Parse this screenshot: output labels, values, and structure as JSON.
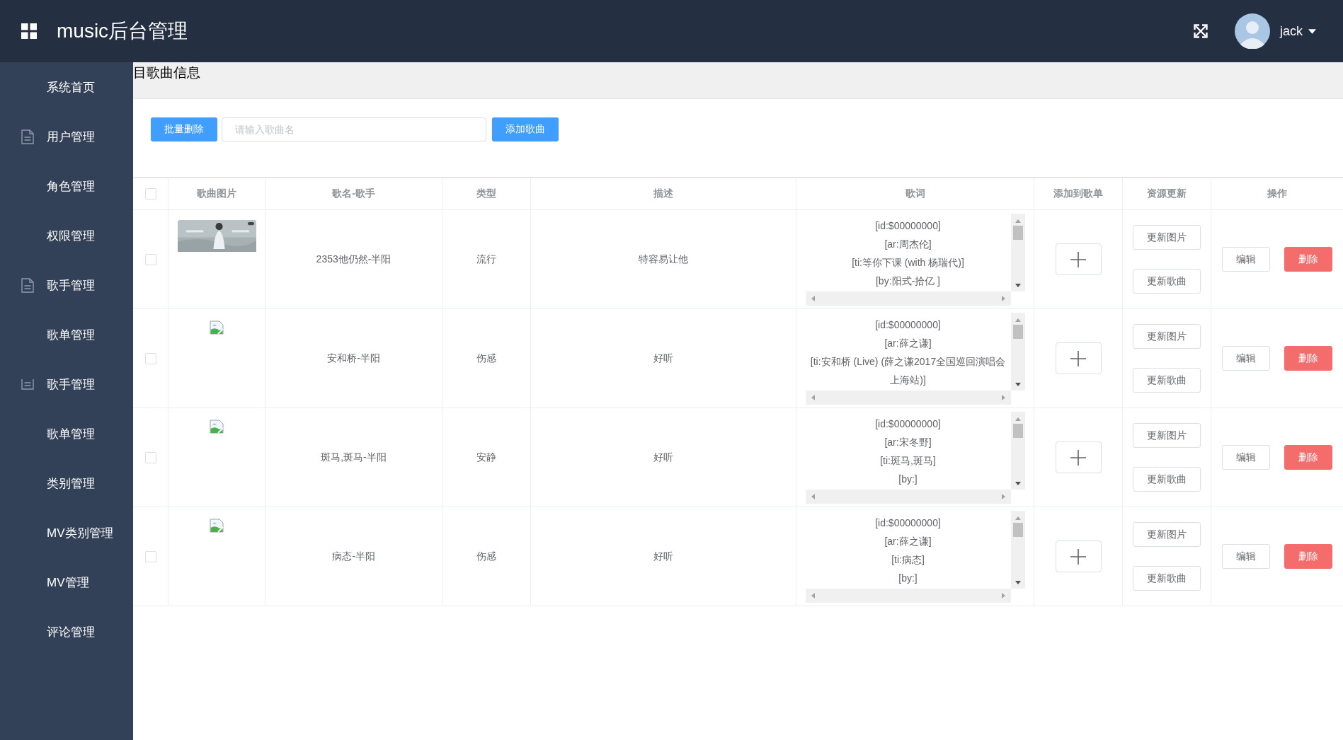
{
  "header": {
    "title": "music后台管理",
    "user": {
      "name": "jack"
    }
  },
  "sidebar": {
    "items": [
      {
        "label": "系统首页",
        "kind": "plain"
      },
      {
        "label": "用户管理",
        "kind": "document"
      },
      {
        "label": "角色管理",
        "kind": "plain"
      },
      {
        "label": "权限管理",
        "kind": "plain"
      },
      {
        "label": "歌手管理",
        "kind": "document"
      },
      {
        "label": "歌单管理",
        "kind": "plain"
      },
      {
        "label": "歌手管理",
        "kind": "list"
      },
      {
        "label": "歌单管理",
        "kind": "plain"
      },
      {
        "label": "类别管理",
        "kind": "plain"
      },
      {
        "label": "MV类别管理",
        "kind": "plain"
      },
      {
        "label": "MV管理",
        "kind": "plain"
      },
      {
        "label": "评论管理",
        "kind": "plain"
      }
    ]
  },
  "breadcrumb": "目歌曲信息",
  "toolbar": {
    "delete_button": "批量删除",
    "search": {
      "placeholder": "请输入歌曲名"
    },
    "add_button": "添加歌曲"
  },
  "table": {
    "select_all": {
      "checked": false
    },
    "columns": [
      "歌曲图片",
      "歌名-歌手",
      "类型",
      "描述",
      "歌词",
      "添加到歌单",
      "资源更新",
      "操作"
    ],
    "rows": [
      {
        "checked": false,
        "image": {
          "kind": "picture"
        },
        "name": "2353他仍然-半阳",
        "type": "流行",
        "description": "特容易让他",
        "lyrics": [
          "[id:$00000000]",
          "[ar:周杰伦]",
          "[ti:等你下课 (with 杨瑞代)]",
          "[by:阳式-拾亿  ]"
        ],
        "resource_buttons": [
          "更新图片",
          "更新歌曲"
        ],
        "actions": [
          {
            "label": "编辑",
            "kind": "plain"
          },
          {
            "label": "删除",
            "kind": "danger"
          }
        ]
      },
      {
        "checked": false,
        "image": {
          "kind": "broken"
        },
        "name": "安和桥-半阳",
        "type": "伤感",
        "description": "好听",
        "lyrics": [
          "[id:$00000000]",
          "[ar:薛之谦]",
          "[ti:安和桥 (Live) (薛之谦2017全国巡回演唱会上海站)]"
        ],
        "resource_buttons": [
          "更新图片",
          "更新歌曲"
        ],
        "actions": [
          {
            "label": "编辑",
            "kind": "plain"
          },
          {
            "label": "删除",
            "kind": "danger"
          }
        ]
      },
      {
        "checked": false,
        "image": {
          "kind": "broken"
        },
        "name": "斑马,斑马-半阳",
        "type": "安静",
        "description": "好听",
        "lyrics": [
          "[id:$00000000]",
          "[ar:宋冬野]",
          "[ti:斑马,斑马]",
          "[by:]"
        ],
        "resource_buttons": [
          "更新图片",
          "更新歌曲"
        ],
        "actions": [
          {
            "label": "编辑",
            "kind": "plain"
          },
          {
            "label": "删除",
            "kind": "danger"
          }
        ]
      },
      {
        "checked": false,
        "image": {
          "kind": "broken"
        },
        "name": "病态-半阳",
        "type": "伤感",
        "description": "好听",
        "lyrics": [
          "[id:$00000000]",
          "[ar:薛之谦]",
          "[ti:病态]",
          "[by:]"
        ],
        "resource_buttons": [
          "更新图片",
          "更新歌曲"
        ],
        "actions": [
          {
            "label": "编辑",
            "kind": "plain"
          },
          {
            "label": "删除",
            "kind": "danger"
          }
        ]
      }
    ]
  }
}
